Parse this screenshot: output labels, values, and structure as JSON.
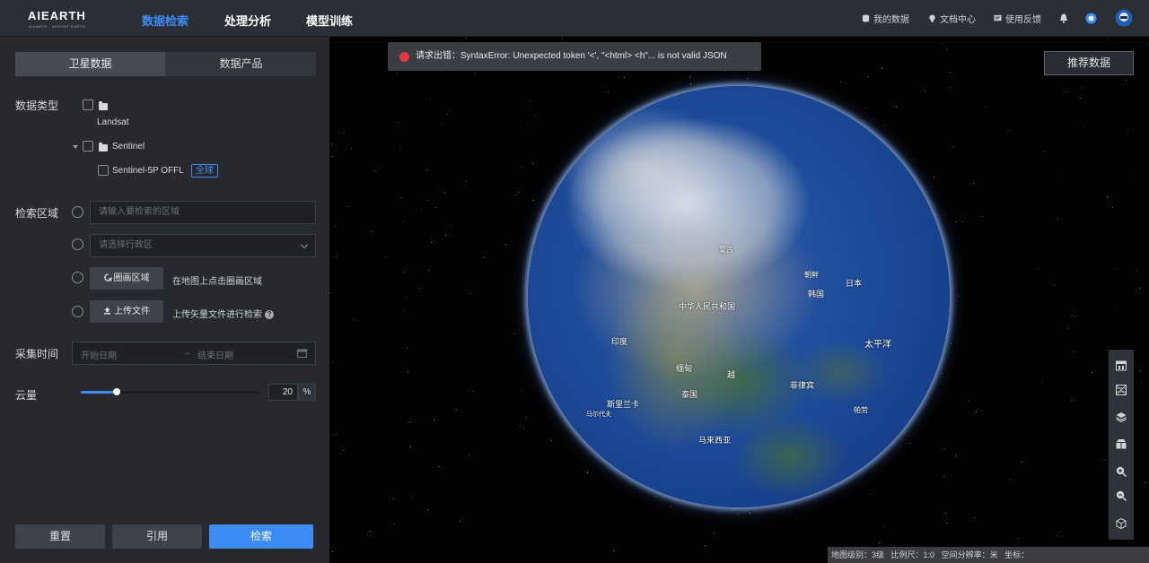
{
  "header": {
    "logo_text": "AIEARTH",
    "logo_sub": "AIEARTH · INSIGHT EARTH",
    "nav": [
      "数据检索",
      "处理分析",
      "模型训练"
    ],
    "active_nav": 0,
    "right": {
      "my_data": "我的数据",
      "docs": "文档中心",
      "feedback": "使用反馈"
    }
  },
  "sidebar": {
    "tabs": [
      "卫星数据",
      "数据产品"
    ],
    "active_tab": 0,
    "data_type_label": "数据类型",
    "tree": {
      "landsat": "Landsat",
      "sentinel": "Sentinel",
      "sentinel_child": "Sentinel-5P OFFL",
      "global_tag": "全球"
    },
    "region_label": "检索区域",
    "region_input_placeholder": "请输入要检索的区域",
    "region_select_placeholder": "请选择行政区",
    "draw_button": "圈画区域",
    "draw_hint": "在地图上点击圈画区域",
    "upload_button": "上传文件",
    "upload_hint": "上传矢量文件进行检索",
    "time_label": "采集时间",
    "start_date_placeholder": "开始日期",
    "end_date_placeholder": "结束日期",
    "date_sep": "→",
    "cloud_label": "云量",
    "cloud_value": "20",
    "cloud_fraction": 0.2,
    "cloud_unit": "%",
    "buttons": {
      "reset": "重置",
      "cite": "引用",
      "search": "检索"
    }
  },
  "map": {
    "error_message": "请求出错：SyntaxError: Unexpected token '<', \"<html> <h\"... is not valid JSON",
    "recommend_button": "推荐数据",
    "labels": [
      "中华人民共和国",
      "日本",
      "韩国",
      "太平洋",
      "菲律宾",
      "印度",
      "缅甸",
      "泰国",
      "越",
      "马来西亚",
      "斯里兰卡",
      "马尔代夫",
      "蒙古",
      "朝鲜",
      "帕劳"
    ],
    "status": {
      "level": "地图级别：3级",
      "scale": "比例尺：1:0",
      "resolution": "空间分辨率：米",
      "coords": "坐标："
    }
  },
  "colors": {
    "accent": "#3d8bf5",
    "error": "#e0393e"
  }
}
